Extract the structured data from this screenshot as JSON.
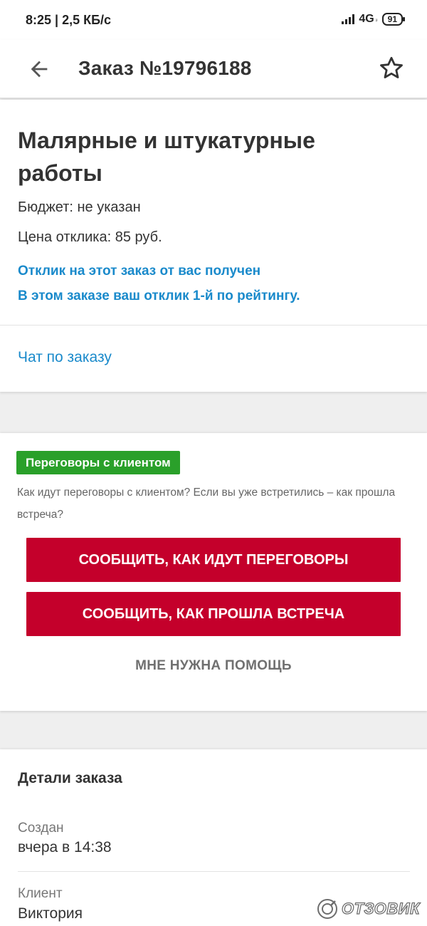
{
  "status_bar": {
    "time_speed": "8:25 | 2,5 КБ/с",
    "network": "4G",
    "network_sub": "ᵢₗ",
    "battery": "91"
  },
  "app_bar": {
    "back_icon": "arrow-left-icon",
    "title": "Заказ №19796188",
    "favorite_icon": "star-outline-icon"
  },
  "order": {
    "title": "Малярные и штукатурные работы",
    "budget": "Бюджет: не указан",
    "response_price": "Цена отклика: 85 руб.",
    "notice_received": "Отклик на этот заказ от вас получен",
    "notice_rating": "В этом заказе ваш отклик 1-й по рейтингу.",
    "chat_link": "Чат по заказу"
  },
  "negotiation": {
    "badge": "Переговоры с клиентом",
    "question": "Как идут переговоры с клиентом? Если вы уже встретились – как прошла встреча?",
    "report_progress_button": "СООБЩИТЬ, КАК ИДУТ ПЕРЕГОВОРЫ",
    "report_meeting_button": "СООБЩИТЬ, КАК ПРОШЛА ВСТРЕЧА",
    "help_button": "МНЕ НУЖНА ПОМОЩЬ"
  },
  "details": {
    "title": "Детали заказа",
    "created_label": "Создан",
    "created_value": "вчера в 14:38",
    "client_label": "Клиент",
    "client_value": "Виктория"
  },
  "watermark": {
    "text": "ОТЗОВИК"
  },
  "colors": {
    "accent_blue": "#1a8acb",
    "button_red": "#c4002b",
    "badge_green": "#2aa02a"
  }
}
